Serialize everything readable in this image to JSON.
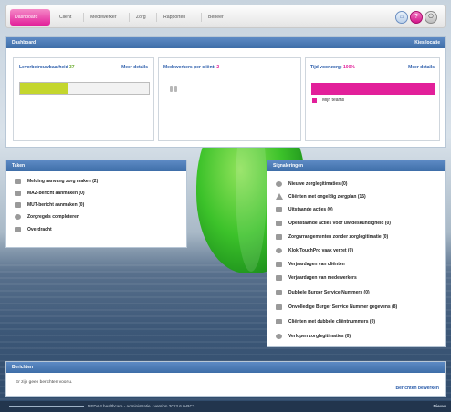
{
  "nav": {
    "tabs": [
      "Dashboard",
      "Cliënt",
      "Medewerker",
      "Zorg",
      "Rapporten",
      "Beheer"
    ],
    "active_tab": "Dashboard"
  },
  "dashboard": {
    "title": "Dashboard",
    "action": "Kies locatie",
    "leverbetrouwbaarheid": {
      "label": "Leverbetrouwbaarheid",
      "value": "37",
      "link": "Meer details",
      "progress": 0.37,
      "bar_color": "#c4d62d"
    },
    "medewerkers": {
      "label": "Medewerkers per cliënt:",
      "value": "2"
    },
    "tijd": {
      "label": "Tijd voor zorg:",
      "value": "100%",
      "link": "Meer details",
      "progress": 1.0,
      "bar_color": "#e2209a",
      "legend": "Mijn teams"
    }
  },
  "taken": {
    "title": "Taken",
    "items": [
      {
        "label": "Melding aanvang zorg maken  (2)",
        "icon": "printer-icon"
      },
      {
        "label": "MAZ-bericht aanmaken  (0)",
        "icon": "document-icon"
      },
      {
        "label": "MUT-bericht aanmaken  (0)",
        "icon": "document-icon"
      },
      {
        "label": "Zorgregels completeren",
        "icon": "circle-icon"
      },
      {
        "label": "Overdracht",
        "icon": "list-icon"
      }
    ]
  },
  "signaleringen": {
    "title": "Signaleringen",
    "items": [
      {
        "label": "Nieuwe zorglegitimaties  (0)",
        "icon": "circle-icon"
      },
      {
        "label": "Cliënten met ongeldig zorgplan  (15)",
        "icon": "warning-icon"
      },
      {
        "label": "Uitstaande acties  (0)",
        "icon": "list-icon"
      },
      {
        "label": "Openstaande acties voor uw deskundigheid  (0)",
        "icon": "list-icon"
      },
      {
        "label": "Zorgarrangementen zonder zorglegitimatie  (0)",
        "icon": "people-icon"
      },
      {
        "label": "Klok TouchPro vaak verzet  (0)",
        "icon": "clock-icon"
      },
      {
        "label": "Verjaardagen van cliënten",
        "icon": "cake-icon"
      },
      {
        "label": "Verjaardagen van medewerkers",
        "icon": "cake-icon"
      },
      {
        "label": "Dubbele Burger Service Nummers  (0)",
        "icon": "id-card-icon"
      },
      {
        "label": "Onvolledige Burger Service Nummer gegevens  (8)",
        "icon": "id-card-icon"
      },
      {
        "label": "Cliënten met dubbele cliëntnummers  (0)",
        "icon": "person-icon"
      },
      {
        "label": "Verlopen zorglegitimaties  (0)",
        "icon": "circle-icon"
      }
    ]
  },
  "berichten": {
    "title": "Berichten",
    "empty": "Er zijn geen berichten voor u.",
    "action": "Berichten bewerken"
  },
  "footer": {
    "text": "NEDAP healthcare - administratie - version 2013.6.0-RC3",
    "right": "Nieuw"
  }
}
